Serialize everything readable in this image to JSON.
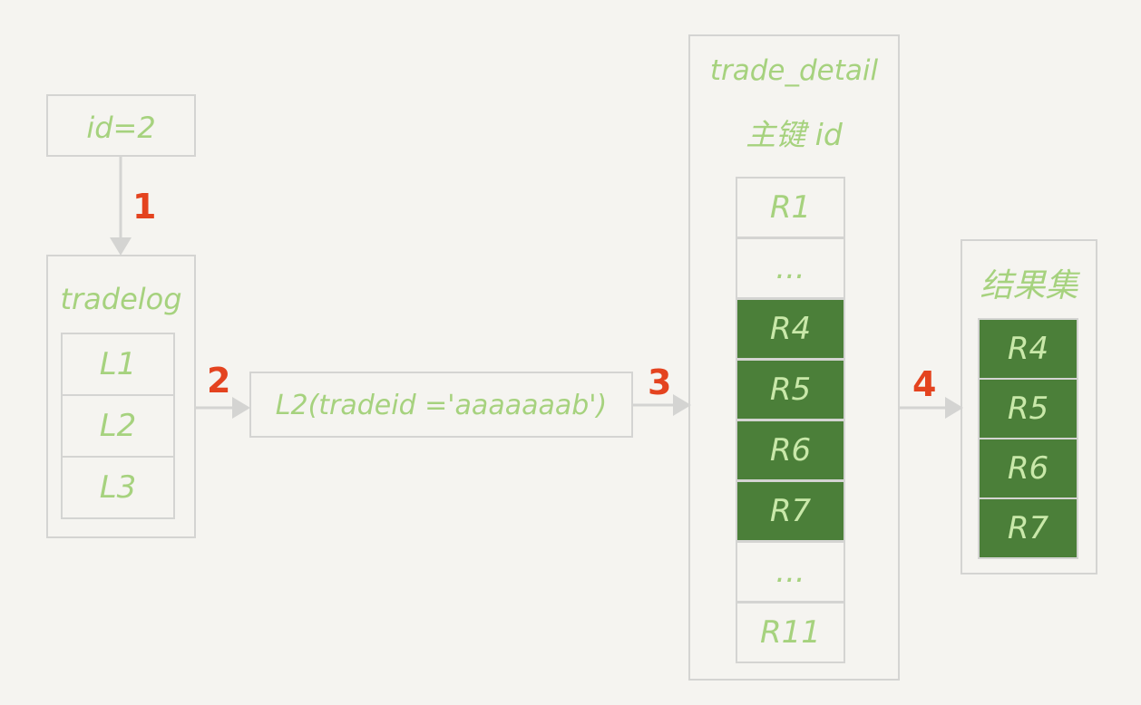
{
  "start": {
    "label": "id=2"
  },
  "tradelog": {
    "title": "tradelog",
    "rows": [
      "L1",
      "L2",
      "L3"
    ]
  },
  "lookup": {
    "label": "L2(tradeid ='aaaaaaab')"
  },
  "trade_detail": {
    "title_line1": "trade_detail",
    "title_line2": "主键 id",
    "rows": [
      {
        "label": "R1",
        "highlight": false
      },
      {
        "label": "...",
        "highlight": false
      },
      {
        "label": "R4",
        "highlight": true
      },
      {
        "label": "R5",
        "highlight": true
      },
      {
        "label": "R6",
        "highlight": true
      },
      {
        "label": "R7",
        "highlight": true
      },
      {
        "label": "...",
        "highlight": false
      },
      {
        "label": "R11",
        "highlight": false
      }
    ]
  },
  "result": {
    "title": "结果集",
    "rows": [
      "R4",
      "R5",
      "R6",
      "R7"
    ]
  },
  "steps": [
    "1",
    "2",
    "3",
    "4"
  ],
  "colors": {
    "background": "#f5f4f0",
    "border": "#d4d4d2",
    "text_green": "#a6d27e",
    "highlight_fill": "#4b7f39",
    "step_number": "#e4431f"
  }
}
